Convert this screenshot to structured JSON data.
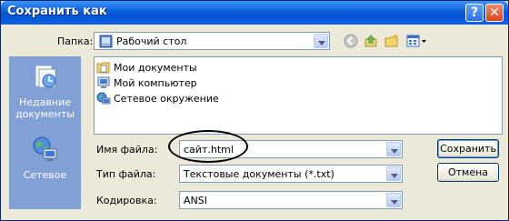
{
  "window": {
    "title": "Сохранить как"
  },
  "titlebar_buttons": {
    "help": "?",
    "close": "✕"
  },
  "folder": {
    "label": "Папка:",
    "value": "Рабочий стол"
  },
  "places": [
    {
      "label": "Недавние документы",
      "icon": "recent-documents-icon"
    },
    {
      "label": "Сетевое",
      "icon": "network-icon"
    }
  ],
  "files": [
    {
      "name": "Мои документы",
      "icon": "my-documents-icon"
    },
    {
      "name": "Мой компьютер",
      "icon": "my-computer-icon"
    },
    {
      "name": "Сетевое окружение",
      "icon": "network-places-icon"
    }
  ],
  "form": {
    "filename_label": "Имя файла:",
    "filename_value": "сайт.html",
    "filetype_label": "Тип файла:",
    "filetype_value": "Текстовые документы (*.txt)",
    "encoding_label": "Кодировка:",
    "encoding_value": "ANSI"
  },
  "buttons": {
    "save": "Сохранить",
    "cancel": "Отмена"
  },
  "colors": {
    "titlebar": "#0a5fd8",
    "places_bar": "#81a0d6",
    "dialog_bg": "#ece9d8",
    "annotation": "#000000"
  }
}
